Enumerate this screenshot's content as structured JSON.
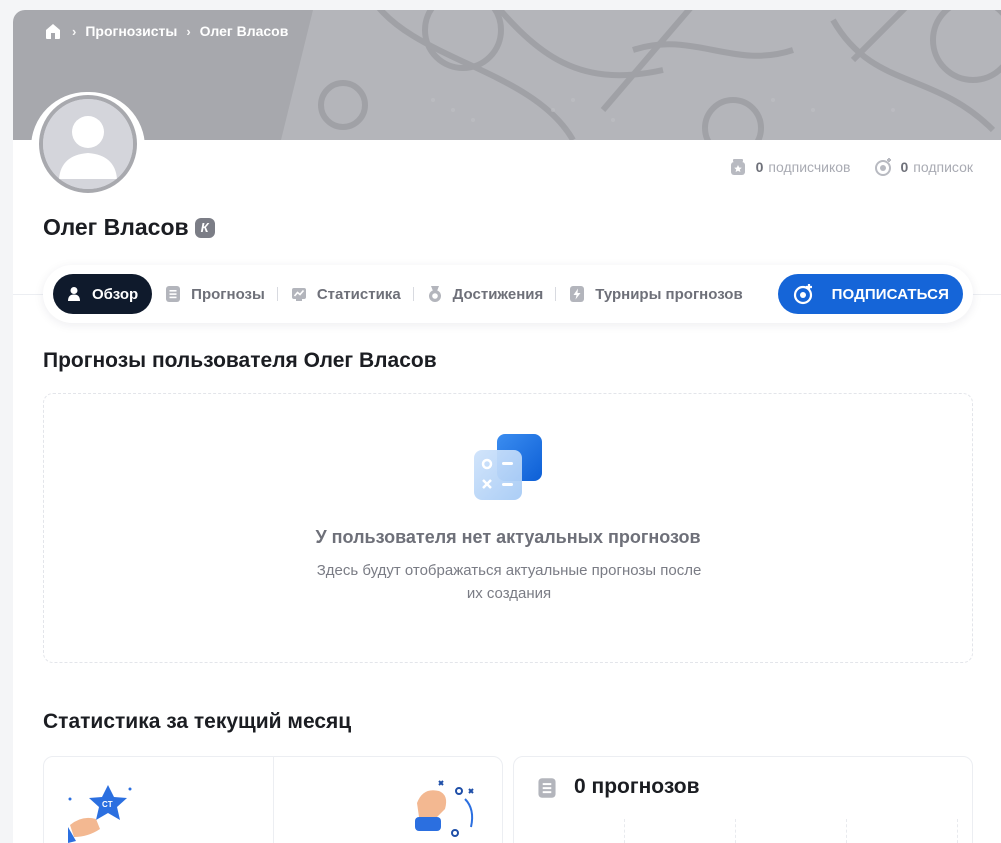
{
  "breadcrumb": {
    "home_icon": "home-icon",
    "items": [
      "Прогнозисты",
      "Олег Власов"
    ]
  },
  "profile": {
    "name": "Олег Власов",
    "badge": "К",
    "subscribers_count": "0",
    "subscribers_label": "подписчиков",
    "subscriptions_count": "0",
    "subscriptions_label": "подписок"
  },
  "tabs": [
    {
      "label": "Обзор",
      "icon": "user-icon",
      "active": true
    },
    {
      "label": "Прогнозы",
      "icon": "list-icon"
    },
    {
      "label": "Статистика",
      "icon": "chart-icon"
    },
    {
      "label": "Достижения",
      "icon": "medal-icon"
    },
    {
      "label": "Турниры прогнозов",
      "icon": "lightning-icon"
    }
  ],
  "subscribe_button": "ПОДПИСАТЬСЯ",
  "predictions_section": {
    "title": "Прогнозы пользователя Олег Власов",
    "empty_title": "У пользователя нет актуальных прогнозов",
    "empty_description": "Здесь будут отображаться актуальные прогнозы после их создания"
  },
  "stats_section": {
    "title": "Статистика за текущий месяц",
    "predictions_count_label": "0 прогнозов"
  },
  "colors": {
    "accent": "#1565d8",
    "active_tab": "#0f1a2c",
    "banner": "#a7a8ad"
  }
}
